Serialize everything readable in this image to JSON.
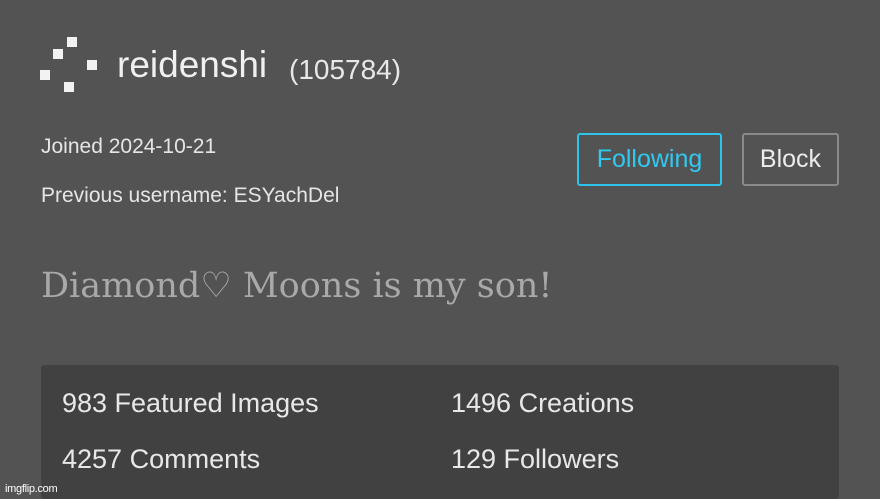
{
  "profile": {
    "username": "reidenshi",
    "user_id": "(105784)",
    "joined": "Joined 2024-10-21",
    "previous_username": "Previous username: ESYachDel",
    "bio": "Diamond♡ Moons is my son!"
  },
  "actions": {
    "following_label": "Following",
    "block_label": "Block",
    "following_color": "#31c9ef"
  },
  "stats": {
    "featured_images": "983 Featured Images",
    "creations": "1496 Creations",
    "comments": "4257 Comments",
    "followers": "129 Followers"
  },
  "watermark": "imgflip.com",
  "avatar_icon": "pixel-identicon-icon"
}
